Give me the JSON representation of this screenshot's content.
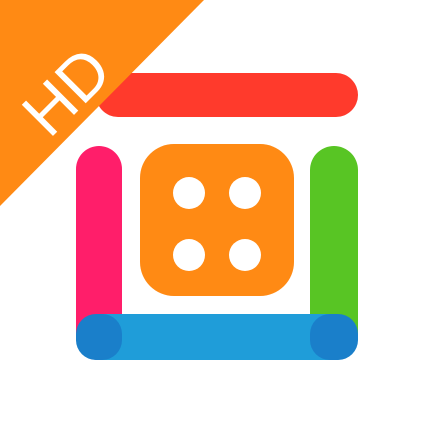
{
  "badge": {
    "label": "HD",
    "color": "#FF8A14",
    "text_color": "#FFFFFF"
  },
  "icon": {
    "name": "app-icon",
    "colors": {
      "top_bar": "#FF3A2C",
      "left_bar": "#FF1E6A",
      "right_bar": "#58C524",
      "bottom_bar": "#1F9DD9",
      "bottom_bar_dark": "#1A7FCA",
      "dice_face": "#FF8A14",
      "dice_pips": "#FFFFFF"
    }
  }
}
